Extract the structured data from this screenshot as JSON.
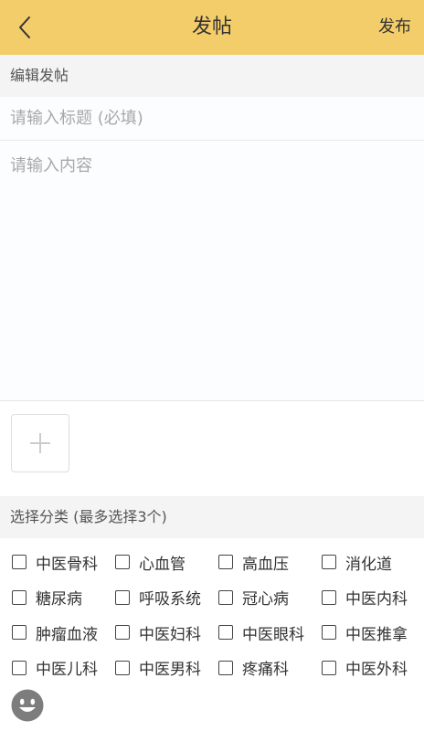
{
  "header": {
    "title": "发帖",
    "publish_label": "发布",
    "background_color": "#f4cd6b",
    "back_icon": "chevron-left-icon"
  },
  "edit_section": {
    "label": "编辑发帖"
  },
  "form": {
    "title_placeholder": "请输入标题 (必填)",
    "title_value": "",
    "content_placeholder": "请输入内容",
    "content_value": ""
  },
  "media": {
    "add_icon": "plus-icon"
  },
  "category_section": {
    "label": "选择分类 (最多选择3个)",
    "rows": [
      [
        {
          "label": "中医骨科",
          "checked": false
        },
        {
          "label": "心血管",
          "checked": false
        },
        {
          "label": "高血压",
          "checked": false
        },
        {
          "label": "消化道",
          "checked": false
        }
      ],
      [
        {
          "label": "糖尿病",
          "checked": false
        },
        {
          "label": "呼吸系统",
          "checked": false
        },
        {
          "label": "冠心病",
          "checked": false
        },
        {
          "label": "中医内科",
          "checked": false
        }
      ],
      [
        {
          "label": "肿瘤血液",
          "checked": false
        },
        {
          "label": "中医妇科",
          "checked": false
        },
        {
          "label": "中医眼科",
          "checked": false
        },
        {
          "label": "中医推拿",
          "checked": false
        }
      ],
      [
        {
          "label": "中医儿科",
          "checked": false
        },
        {
          "label": "中医男科",
          "checked": false
        },
        {
          "label": "疼痛科",
          "checked": false
        },
        {
          "label": "中医外科",
          "checked": false
        }
      ]
    ]
  },
  "footer": {
    "emoji_icon": "smiley-face-icon"
  }
}
